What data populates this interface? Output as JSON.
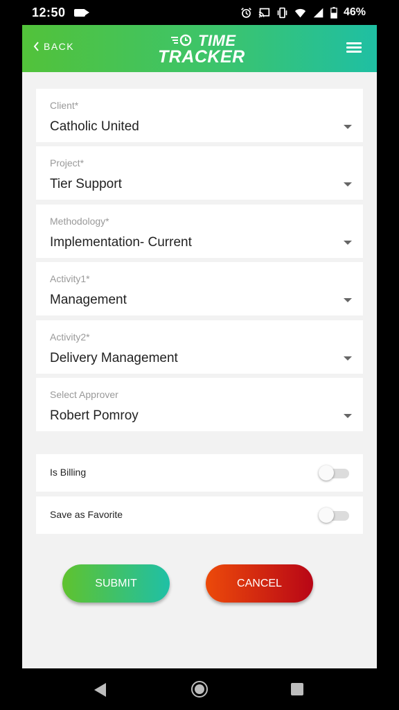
{
  "status_bar": {
    "time": "12:50",
    "battery": "46%"
  },
  "header": {
    "back_label": "BACK",
    "logo_line1": "TIME",
    "logo_line2": "TRACKER"
  },
  "fields": [
    {
      "label": "Client*",
      "value": "Catholic United"
    },
    {
      "label": "Project*",
      "value": "Tier Support"
    },
    {
      "label": "Methodology*",
      "value": "Implementation- Current"
    },
    {
      "label": "Activity1*",
      "value": "Management"
    },
    {
      "label": "Activity2*",
      "value": "Delivery Management"
    },
    {
      "label": "Select Approver",
      "value": "Robert Pomroy"
    }
  ],
  "toggles": [
    {
      "label": "Is Billing",
      "on": false
    },
    {
      "label": "Save as Favorite",
      "on": false
    }
  ],
  "buttons": {
    "submit": "SUBMIT",
    "cancel": "CANCEL"
  },
  "colors": {
    "header_start": "#52c23a",
    "header_end": "#1fbfa3",
    "cancel_start": "#ec4a0a",
    "cancel_end": "#b80616"
  },
  "icons": [
    "video-icon",
    "alarm-icon",
    "cast-icon",
    "vibrate-icon",
    "wifi-icon",
    "signal-icon",
    "battery-icon",
    "chevron-left-icon",
    "stopwatch-icon",
    "hamburger-menu-icon",
    "caret-down-icon",
    "nav-back-icon",
    "nav-home-icon",
    "nav-recents-icon"
  ]
}
